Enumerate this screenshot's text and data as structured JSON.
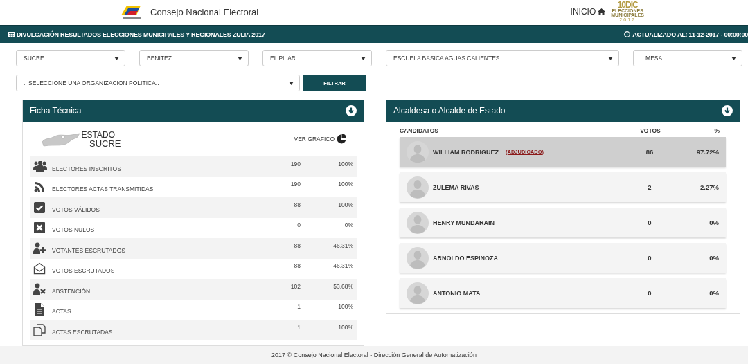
{
  "header": {
    "org_name": "Consejo Nacional Electoral",
    "home_link": "INICIO",
    "event_logo": {
      "big": "10DIC",
      "line1": "ELECCIONES",
      "line2": "MUNICIPALES",
      "year": "2017"
    }
  },
  "title_bar": {
    "title": "DIVULGACIÓN RESULTADOS ELECCIONES MUNICIPALES Y REGIONALES ZULIA 2017",
    "updated": "ACTUALIZADO AL: 11-12-2017 - 00:00:00"
  },
  "filters": [
    {
      "value": "SUCRE"
    },
    {
      "value": "BENITEZ"
    },
    {
      "value": "EL PILAR"
    },
    {
      "value": "ESCUELA BÁSICA AGUAS CALIENTES"
    },
    {
      "value": ":: MESA ::"
    }
  ],
  "org_filter": {
    "value": ":: SELECCIONE UNA ORGANIZACIÓN POLITICA::",
    "button": "FILTRAR"
  },
  "ficha": {
    "title": "Ficha Técnica",
    "state_label_1": "ESTADO",
    "state_label_2": "SUCRE",
    "chart_link": "VER GRÁFICO",
    "rows": [
      {
        "kind": "users",
        "label": "ELECTORES INSCRITOS",
        "count": "190",
        "pct": "100%"
      },
      {
        "kind": "rss",
        "label": "ELECTORES ACTAS TRANSMITIDAS",
        "count": "190",
        "pct": "100%"
      },
      {
        "kind": "check",
        "label": "VOTOS VÁLIDOS",
        "count": "88",
        "pct": "100%"
      },
      {
        "kind": "cross",
        "label": "VOTOS NULOS",
        "count": "0",
        "pct": "0%"
      },
      {
        "kind": "user-plus",
        "label": "VOTANTES ESCRUTADOS",
        "count": "88",
        "pct": "46.31%"
      },
      {
        "kind": "envelope",
        "label": "VOTOS ESCRUTADOS",
        "count": "88",
        "pct": "46.31%"
      },
      {
        "kind": "user-cross",
        "label": "ABSTENCIÓN",
        "count": "102",
        "pct": "53.68%"
      },
      {
        "kind": "file",
        "label": "ACTAS",
        "count": "1",
        "pct": "100%"
      },
      {
        "kind": "copies",
        "label": "ACTAS ESCRUTADAS",
        "count": "1",
        "pct": "100%"
      }
    ]
  },
  "results": {
    "title": "Alcaldesa o Alcalde de Estado",
    "columns": [
      "CANDIDATOS",
      "VOTOS",
      "%"
    ],
    "candidates": [
      {
        "name": "WILLIAM RODRIGUEZ",
        "tag": "(ADJUDICADO)",
        "votes": "86",
        "pct": "97.72%",
        "highlighted": true
      },
      {
        "name": "ZULEMA RIVAS",
        "votes": "2",
        "pct": "2.27%",
        "highlighted": false
      },
      {
        "name": "HENRY MUNDARAIN",
        "votes": "0",
        "pct": "0%",
        "highlighted": false
      },
      {
        "name": "ARNOLDO ESPINOZA",
        "votes": "0",
        "pct": "0%",
        "highlighted": false
      },
      {
        "name": "ANTONIO MATA",
        "votes": "0",
        "pct": "0%",
        "highlighted": false
      }
    ]
  },
  "footer": "2017 © Consejo Nacional Electoral - Dirección General de Automatización"
}
